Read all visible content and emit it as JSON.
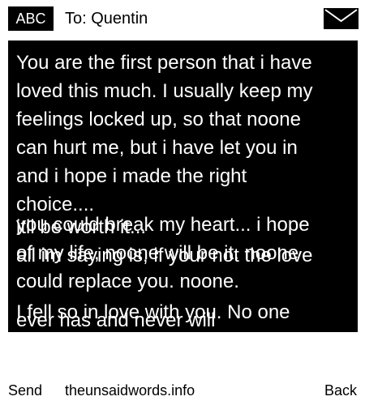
{
  "header": {
    "mode_badge": "ABC",
    "recipient": "To: Quentin",
    "icon": "envelope-icon"
  },
  "message": {
    "blocks": [
      "You are the first person that i have\nloved this much. I usually keep my\nfeelings locked up, so that noone\ncan hurt me, but i have let you in\nand i hope i made the right\nchoice....",
      "itll be worth it...\nall im saying is, if your not the love",
      "you could break my heart... i hope\nof my life, noone will be it. noone\ncould replace you. noone.",
      "I fell so in love with you. No one",
      "ever has and never will"
    ]
  },
  "footer": {
    "send_label": "Send",
    "site_label": "theunsaidwords.info",
    "back_label": "Back"
  },
  "colors": {
    "panel_background": "#000000",
    "panel_text": "#ffffff",
    "page_background": "#ffffff"
  }
}
